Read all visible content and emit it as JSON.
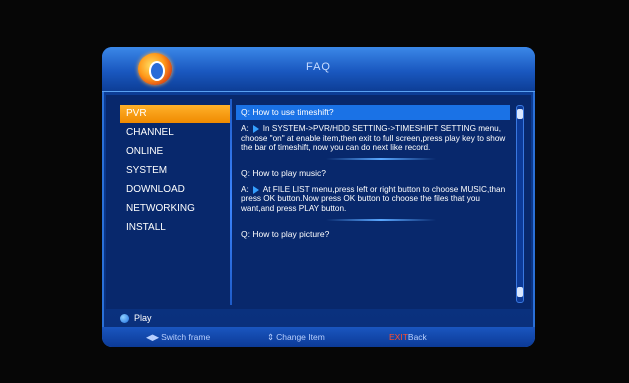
{
  "header": {
    "title": "FAQ"
  },
  "menu": {
    "items": [
      {
        "label": "PVR",
        "selected": true
      },
      {
        "label": "CHANNEL"
      },
      {
        "label": "ONLINE"
      },
      {
        "label": "SYSTEM"
      },
      {
        "label": "DOWNLOAD"
      },
      {
        "label": "NETWORKING"
      },
      {
        "label": "INSTALL"
      }
    ]
  },
  "faq": [
    {
      "question": "Q: How to use timeshift?",
      "answer_prefix": "A:",
      "answer": "In SYSTEM->PVR/HDD SETTING->TIMESHIFT SETTING menu, choose \"on\" at enable item,then exit to full screen,press play key to show the bar of timeshift, now you can do next like record."
    },
    {
      "question": "Q: How to play music?",
      "answer_prefix": "A:",
      "answer": "At FILE LIST menu,press left or right button to choose MUSIC,than press OK button.Now press OK button to choose the files that you want,and press PLAY button."
    },
    {
      "question": "Q: How to play picture?"
    }
  ],
  "hint": {
    "label": "Play"
  },
  "footer": {
    "switch_icon": "◀▶",
    "switch_label": "Switch frame",
    "change_icon": "⇕",
    "change_label": "Change Item",
    "exit_key": "EXIT",
    "exit_label": "Back"
  }
}
